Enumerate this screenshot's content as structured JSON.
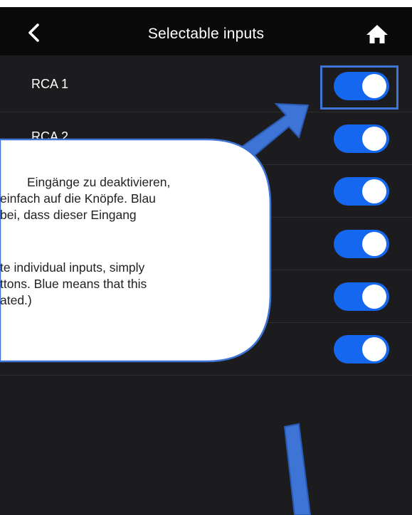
{
  "header": {
    "title": "Selectable inputs",
    "back_icon": "chevron-left-icon",
    "home_icon": "home-icon"
  },
  "inputs": [
    {
      "label": "RCA 1",
      "enabled": true
    },
    {
      "label": "RCA 2",
      "enabled": true
    },
    {
      "label": "",
      "enabled": true
    },
    {
      "label": "",
      "enabled": true
    },
    {
      "label": "",
      "enabled": true
    },
    {
      "label": "",
      "enabled": true
    }
  ],
  "callout": {
    "lines": [
      "Eingänge zu deaktivieren,",
      "einfach auf die Knöpfe. Blau",
      "bei, dass dieser Eingang",
      "",
      "te individual inputs, simply",
      "ttons. Blue means that this",
      "ated.)"
    ]
  },
  "colors": {
    "toggle_on": "#1667f0",
    "background": "#1c1c1e",
    "topbar": "#0a0a0a",
    "annotation_blue": "#3d74d6",
    "callout_border": "#3d74d6"
  }
}
